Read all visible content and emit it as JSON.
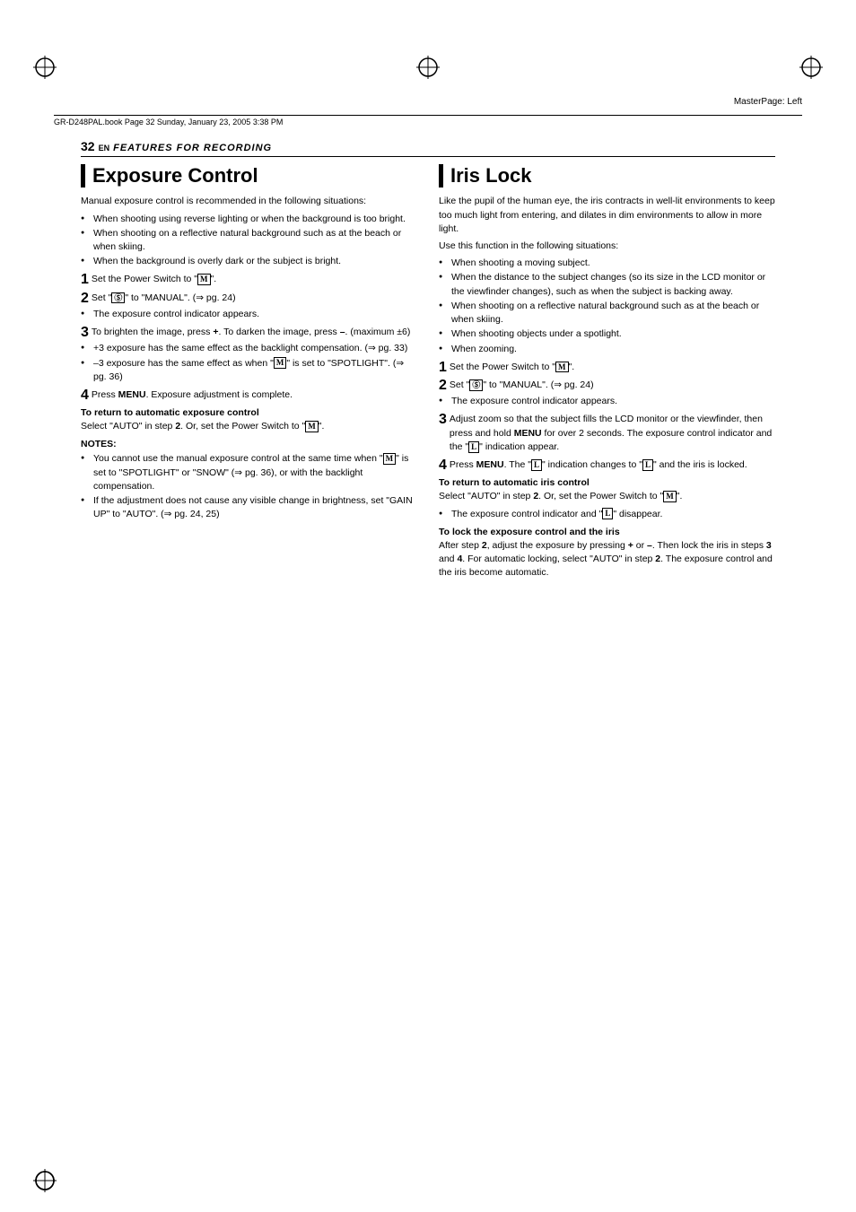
{
  "masterPageLabel": "MasterPage: Left",
  "fileInfo": "GR-D248PAL.book  Page 32  Sunday, January 23, 2005  3:38 PM",
  "pageNumber": "32",
  "langTag": "EN",
  "sectionTitle": "FEATURES FOR RECORDING",
  "exposureControl": {
    "title": "Exposure Control",
    "intro": "Manual exposure control is recommended in the following situations:",
    "bullets": [
      "When shooting using reverse lighting or when the background is too bright.",
      "When shooting on a reflective natural background such as at the beach or when skiing.",
      "When the background is overly dark or the subject is bright."
    ],
    "steps": [
      {
        "num": "1",
        "text": "Set the Power Switch to \"⒩\"."
      },
      {
        "num": "2",
        "text": "Set \"ⓢ\" to \"MANUAL\". (⇒ pg. 24)"
      },
      {
        "num": "2b",
        "text": "The exposure control indicator appears.",
        "isBullet": true
      },
      {
        "num": "3",
        "text": "To brighten the image, press +. To darken the image, press –. (maximum ±6)"
      }
    ],
    "step3bullets": [
      "+3 exposure has the same effect as the backlight compensation. (⇒ pg. 33)",
      "–3 exposure has the same effect as when \"⒩\" is set to \"SPOTLIGHT\". (⇒ pg. 36)"
    ],
    "step4": "Press MENU. Exposure adjustment is complete.",
    "returnHeading": "To return to automatic exposure control",
    "returnText": "Select \"AUTO\" in step 2. Or, set the Power Switch to \"⒩\".",
    "notesHeading": "NOTES:",
    "notes": [
      "You cannot use the manual exposure control at the same time when \"⒩\" is set to \"SPOTLIGHT\" or \"SNOW\" (⇒ pg. 36), or with the backlight compensation.",
      "If the adjustment does not cause any visible change in brightness, set \"GAIN UP\" to \"AUTO\". (⇒ pg. 24, 25)"
    ]
  },
  "irisLock": {
    "title": "Iris Lock",
    "intro": "Like the pupil of the human eye, the iris contracts in well-lit environments to keep too much light from entering, and dilates in dim environments to allow in more light.",
    "intro2": "Use this function in the following situations:",
    "bullets": [
      "When shooting a moving subject.",
      "When the distance to the subject changes (so its size in the LCD monitor or the viewfinder changes), such as when the subject is backing away.",
      "When shooting on a reflective natural background such as at the beach or when skiing.",
      "When shooting objects under a spotlight.",
      "When zooming."
    ],
    "steps": [
      {
        "num": "1",
        "text": "Set the Power Switch to \"⒩\"."
      },
      {
        "num": "2",
        "text": "Set \"ⓢ\" to \"MANUAL\". (⇒ pg. 24)"
      },
      {
        "num": "2b",
        "text": "The exposure control indicator appears.",
        "isBullet": true
      },
      {
        "num": "3",
        "text": "Adjust zoom so that the subject fills the LCD monitor or the viewfinder, then press and hold MENU for over 2 seconds. The exposure control indicator and the \"Ⓛ\" indication appear."
      },
      {
        "num": "4",
        "text": "Press MENU. The \"Ⓛ\" indication changes to \"Ⓛ\" and the iris is locked."
      }
    ],
    "returnAutoIrisHeading": "To return to automatic iris control",
    "returnAutoIrisText": "Select \"AUTO\" in step 2. Or, set the Power Switch to \"⒩\".",
    "returnAutoIrisBullet": "The exposure control indicator and \"Ⓛ\" disappear.",
    "lockHeading": "To lock the exposure control and the iris",
    "lockText": "After step 2, adjust the exposure by pressing + or –. Then lock the iris in steps 3 and 4. For automatic locking, select \"AUTO\" in step 2. The exposure control and the iris become automatic."
  }
}
